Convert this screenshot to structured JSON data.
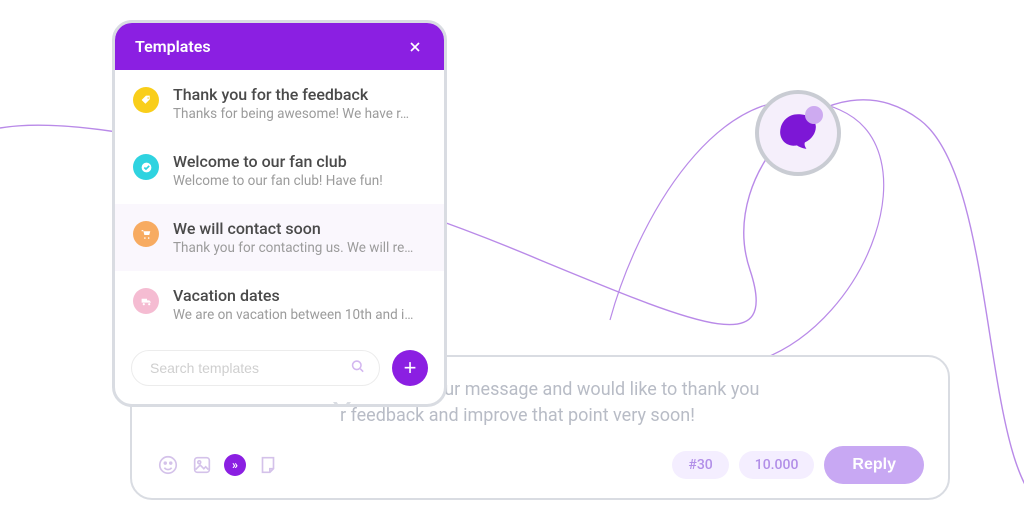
{
  "templates_panel": {
    "title": "Templates",
    "search_placeholder": "Search templates",
    "items": [
      {
        "title": "Thank you for the feedback",
        "subtitle": "Thanks for being awesome!  We have r…",
        "icon": "tag-icon",
        "color": "yellow"
      },
      {
        "title": "Welcome to our fan club",
        "subtitle": "Welcome to our fan club! Have fun!",
        "icon": "check-icon",
        "color": "cyan"
      },
      {
        "title": "We will contact soon",
        "subtitle": "Thank you for contacting us. We will re…",
        "icon": "cart-icon",
        "color": "orange",
        "selected": true
      },
      {
        "title": "Vacation dates",
        "subtitle": "We are on vacation between 10th and i…",
        "icon": "truck-icon",
        "color": "pink"
      }
    ]
  },
  "reply_box": {
    "message_line1": "e received your message and would like to thank you",
    "message_line2": "r feedback and improve that point very soon!",
    "chip_hash": "#30",
    "chip_count": "10.000",
    "reply_label": "Reply"
  }
}
